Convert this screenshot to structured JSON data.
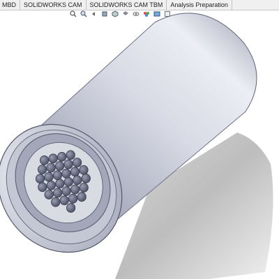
{
  "command_manager": {
    "tabs": [
      {
        "label": "MBD"
      },
      {
        "label": "SOLIDWORKS CAM"
      },
      {
        "label": "SOLIDWORKS CAM TBM"
      },
      {
        "label": "Analysis Preparation"
      }
    ]
  },
  "heads_up_toolbar": {
    "icons": [
      "zoom-to-fit-icon",
      "zoom-to-area-icon",
      "previous-view-icon",
      "section-view-icon",
      "view-orientation-icon",
      "display-style-icon",
      "hide-show-items-icon",
      "edit-appearance-icon",
      "apply-scene-icon",
      "view-settings-icon"
    ]
  },
  "model": {
    "description_visible": false,
    "tube_count": 31,
    "colors": {
      "body_light": "#e9ebf2",
      "body_mid": "#b9bccb",
      "body_dark": "#7f8296",
      "shadow": "#b8b8b8",
      "flange": "#d0d2dc",
      "tube_face": "#5f6378"
    }
  }
}
